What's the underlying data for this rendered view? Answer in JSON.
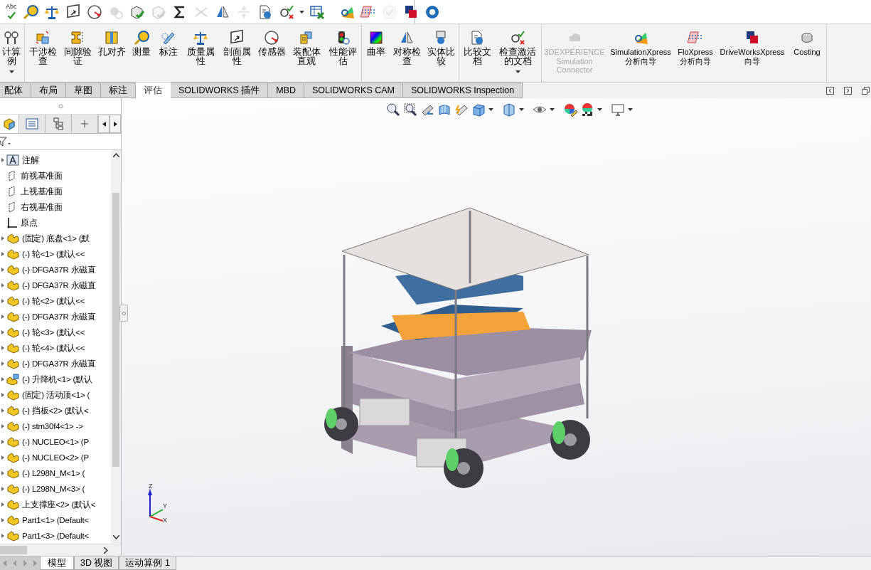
{
  "quick_toolbar": {
    "items": [
      {
        "label": "Abc",
        "disabled": false
      },
      {
        "disabled": false
      },
      {
        "disabled": false
      },
      {
        "disabled": false
      },
      {
        "disabled": false
      },
      {
        "disabled": true
      },
      {
        "disabled": false
      },
      {
        "disabled": true
      },
      {
        "disabled": false
      },
      {
        "disabled": true
      },
      {
        "disabled": false
      },
      {
        "disabled": true
      },
      {
        "disabled": false
      },
      {
        "disabled": false,
        "dropdown": true
      },
      {
        "disabled": false
      },
      {
        "disabled": false
      },
      {
        "disabled": false
      },
      {
        "disabled": true
      },
      {
        "disabled": false
      },
      {
        "disabled": false
      }
    ]
  },
  "ribbon": {
    "groups": [
      {
        "buttons": [
          {
            "label": "计算例",
            "dropdown": true,
            "disabled": false
          }
        ]
      },
      {
        "buttons": [
          {
            "label": "干涉检查",
            "disabled": false
          },
          {
            "label": "间隙验证",
            "disabled": false
          },
          {
            "label": "孔对齐",
            "disabled": false
          },
          {
            "label": "测量",
            "disabled": false
          },
          {
            "label": "标注",
            "disabled": false
          },
          {
            "label": "质量属性",
            "disabled": false
          },
          {
            "label": "剖面属性",
            "disabled": false
          },
          {
            "label": "传感器",
            "disabled": false
          },
          {
            "label": "装配体直观",
            "disabled": false
          },
          {
            "label": "性能评估",
            "disabled": false
          }
        ]
      },
      {
        "buttons": [
          {
            "label": "曲率",
            "disabled": false
          },
          {
            "label": "对称检查",
            "disabled": false
          },
          {
            "label": "实体比较",
            "disabled": false
          }
        ]
      },
      {
        "buttons": [
          {
            "label": "比较文档",
            "disabled": false
          },
          {
            "label": "检查激活的文档",
            "dropdown": true,
            "disabled": false
          }
        ]
      },
      {
        "buttons": [
          {
            "label": "3DEXPERIENCE Simulation Connector",
            "disabled": true
          },
          {
            "label": "SimulationXpress 分析向导",
            "disabled": false
          },
          {
            "label": "FloXpress 分析向导",
            "disabled": false
          },
          {
            "label": "DriveWorksXpress 向导",
            "disabled": false
          },
          {
            "label": "Costing",
            "disabled": false
          }
        ]
      }
    ]
  },
  "tabs": [
    {
      "label": "配体",
      "selected": false
    },
    {
      "label": "布局",
      "selected": false
    },
    {
      "label": "草图",
      "selected": false
    },
    {
      "label": "标注",
      "selected": false
    },
    {
      "label": "评估",
      "selected": true
    },
    {
      "label": "SOLIDWORKS 插件",
      "selected": false
    },
    {
      "label": "MBD",
      "selected": false
    },
    {
      "label": "SOLIDWORKS CAM",
      "selected": false
    },
    {
      "label": "SOLIDWORKS Inspection",
      "selected": false
    }
  ],
  "feature_tree": {
    "panel_tabs": [
      {
        "selected": true
      },
      {
        "selected": false
      },
      {
        "selected": false
      },
      {
        "selected": false
      }
    ],
    "items": [
      {
        "kind": "annotation",
        "label": "注解",
        "expandable": true
      },
      {
        "kind": "plane",
        "label": "前视基准面",
        "expandable": false
      },
      {
        "kind": "plane",
        "label": "上视基准面",
        "expandable": false
      },
      {
        "kind": "plane",
        "label": "右视基准面",
        "expandable": false
      },
      {
        "kind": "origin",
        "label": "原点",
        "expandable": false
      },
      {
        "kind": "part",
        "label": "(固定) 底盘<1> (默",
        "expandable": true
      },
      {
        "kind": "part",
        "label": "(-) 轮<1> (默认<<",
        "expandable": true
      },
      {
        "kind": "part",
        "label": "(-) DFGA37R 永磁直",
        "expandable": true
      },
      {
        "kind": "part",
        "label": "(-) DFGA37R 永磁直",
        "expandable": true
      },
      {
        "kind": "part",
        "label": "(-) 轮<2> (默认<<",
        "expandable": true
      },
      {
        "kind": "part",
        "label": "(-) DFGA37R 永磁直",
        "expandable": true
      },
      {
        "kind": "part",
        "label": "(-) 轮<3> (默认<<",
        "expandable": true
      },
      {
        "kind": "part",
        "label": "(-) 轮<4> (默认<<",
        "expandable": true
      },
      {
        "kind": "part",
        "label": "(-) DFGA37R 永磁直",
        "expandable": true
      },
      {
        "kind": "assembly",
        "label": "(-) 升降机<1> (默认",
        "expandable": true
      },
      {
        "kind": "part",
        "label": "(固定) 活动顶<1> (",
        "expandable": true
      },
      {
        "kind": "part",
        "label": "(-) 挡板<2> (默认<",
        "expandable": true
      },
      {
        "kind": "part",
        "label": "(-) stm30f4<1> ->",
        "expandable": true
      },
      {
        "kind": "part",
        "label": "(-) NUCLEO<1> (P",
        "expandable": true
      },
      {
        "kind": "part",
        "label": "(-) NUCLEO<2> (P",
        "expandable": true
      },
      {
        "kind": "part",
        "label": "(-) L298N_M<1> (",
        "expandable": true
      },
      {
        "kind": "part",
        "label": "(-) L298N_M<3> (",
        "expandable": true
      },
      {
        "kind": "part",
        "label": "上支撑座<2> (默认<",
        "expandable": true
      },
      {
        "kind": "part",
        "label": "Part1<1> (Default<",
        "expandable": true
      },
      {
        "kind": "part",
        "label": "Part1<3> (Default<",
        "expandable": true
      }
    ]
  },
  "triad": {
    "labels": [
      "Z",
      "Y",
      "X"
    ]
  },
  "bottom_tabs": [
    {
      "label": "模型",
      "selected": true
    },
    {
      "label": "3D 视图",
      "selected": false
    },
    {
      "label": "运动算例 1",
      "selected": false
    }
  ]
}
